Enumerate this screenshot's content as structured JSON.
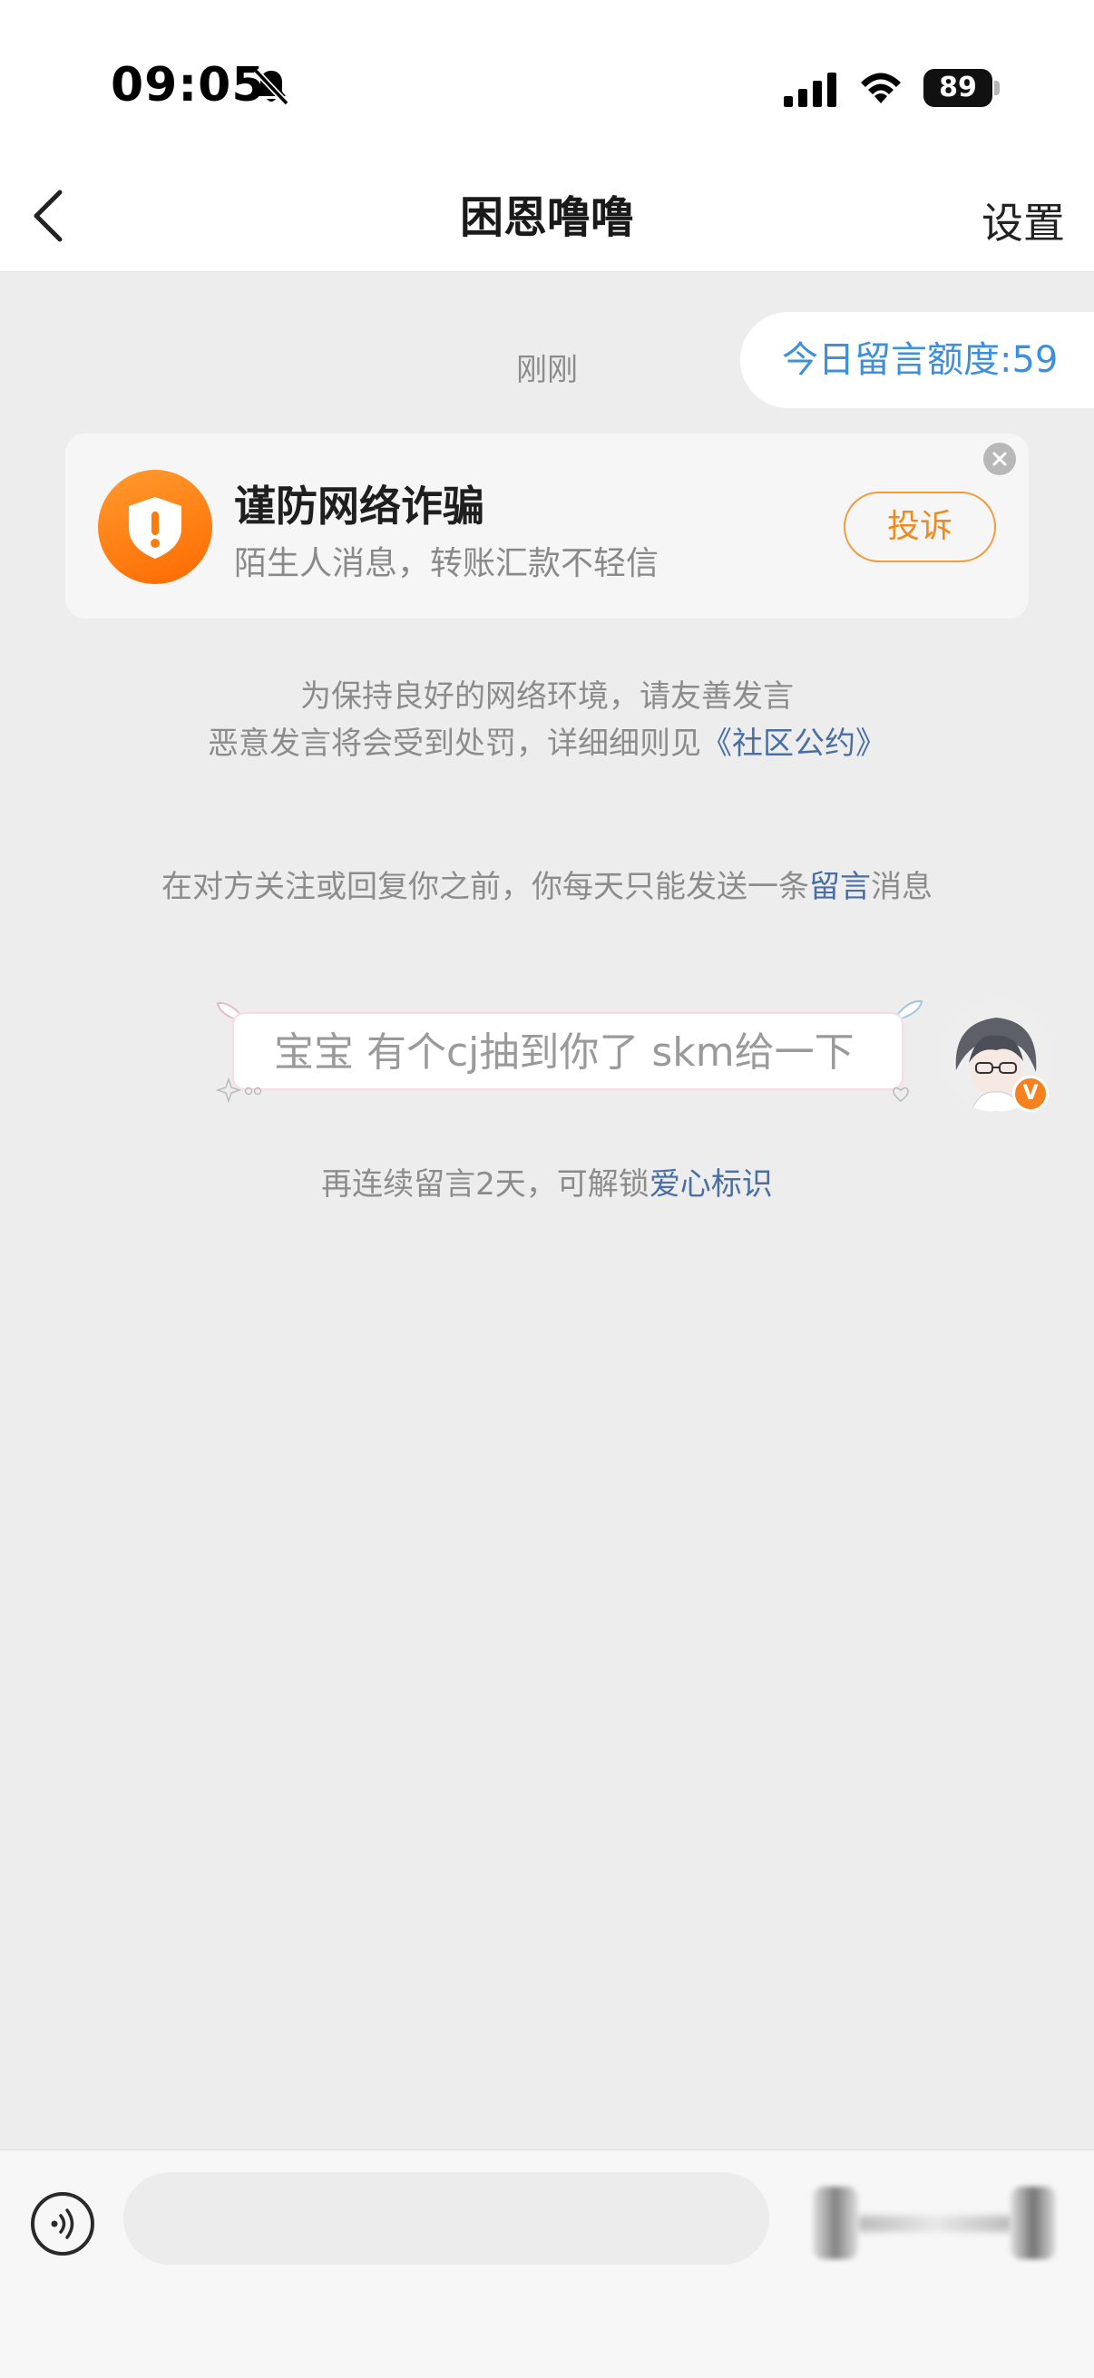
{
  "status_bar": {
    "time": "09:05",
    "battery": "89"
  },
  "nav": {
    "title": "困恩噜噜",
    "settings_label": "设置"
  },
  "quota": {
    "text": "今日留言额度:59"
  },
  "timestamp": "刚刚",
  "warning_card": {
    "title": "谨防网络诈骗",
    "subtitle": "陌生人消息，转账汇款不轻信",
    "report_label": "投诉"
  },
  "notices": {
    "line1": "为保持良好的网络环境，请友善发言",
    "line2_prefix": "恶意发言将会受到处罚，详细细则见",
    "line2_link": "《社区公约》",
    "line3_prefix": "在对方关注或回复你之前，你每天只能发送一条",
    "line3_link": "留言",
    "line3_suffix": "消息"
  },
  "message": {
    "text": "宝宝 有个cj抽到你了 skm给一下"
  },
  "avatar_badge": "V",
  "unlock_notice": {
    "prefix": "再连续留言2天，可解锁",
    "link": "爱心标识"
  },
  "input": {
    "placeholder": ""
  },
  "colors": {
    "accent_blue": "#3d8fe0",
    "warning_orange": "#ff7a0d",
    "link_blue": "#4a6fa5"
  }
}
